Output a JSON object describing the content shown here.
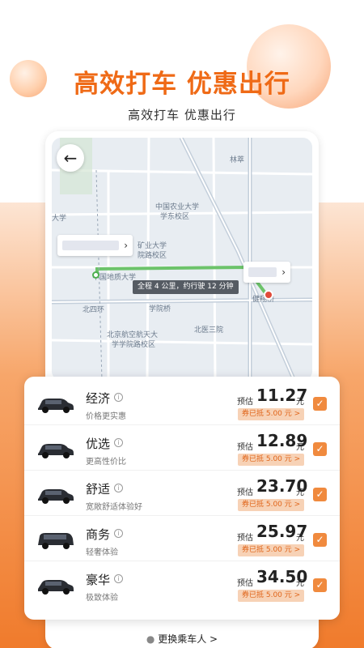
{
  "hero": {
    "headline": "高效打车  优惠出行",
    "subline": "高效打车 优惠出行"
  },
  "map": {
    "labels": [
      "林萃",
      "中国农业大学",
      "学东校区",
      "矿业大学",
      "院路校区",
      "中国地质大学",
      "北四环",
      "学院桥",
      "健翔桥",
      "北京航空航天大",
      "学学院路校区",
      "北医三院",
      "大学"
    ],
    "route_tip": "全程 4 公里，约行驶 12 分钟",
    "back_icon": "arrow-left-icon"
  },
  "rides": [
    {
      "name": "经济",
      "desc": "价格更实惠",
      "est_label": "预估",
      "price": "11.27",
      "unit": "元",
      "coupon": "券已抵 5.00 元 >"
    },
    {
      "name": "优选",
      "desc": "更高性价比",
      "est_label": "预估",
      "price": "12.89",
      "unit": "元",
      "coupon": "券已抵 5.00 元 >"
    },
    {
      "name": "舒适",
      "desc": "宽敞舒适体验好",
      "est_label": "预估",
      "price": "23.70",
      "unit": "元",
      "coupon": "券已抵 5.00 元 >"
    },
    {
      "name": "商务",
      "desc": "轻奢体验",
      "est_label": "预估",
      "price": "25.97",
      "unit": "元",
      "coupon": "券已抵 5.00 元 >"
    },
    {
      "name": "豪华",
      "desc": "极致体验",
      "est_label": "预估",
      "price": "34.50",
      "unit": "元",
      "coupon": "券已抵 5.00 元 >"
    }
  ],
  "bottom": {
    "change_passenger": "更换乘车人 >"
  },
  "colors": {
    "brand": "#ef6a16",
    "checkbox": "#f08a3e",
    "route": "#6cc36a"
  }
}
